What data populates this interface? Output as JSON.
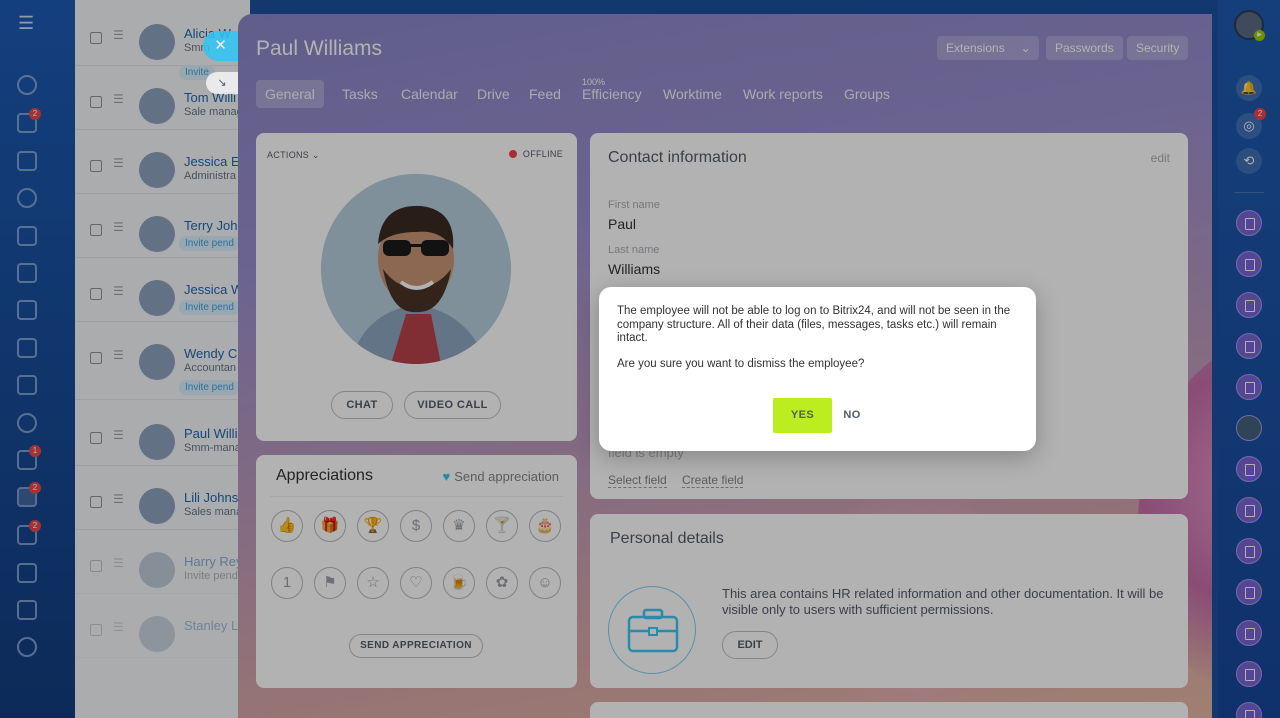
{
  "leftnav": {
    "badges": [
      "2",
      "1",
      "2",
      "2"
    ]
  },
  "employee_list": {
    "rows": [
      {
        "name": "Alicia W",
        "position": "Smm",
        "tag": "Invite"
      },
      {
        "name": "Tom Willi",
        "position": "Sale manag",
        "tag": ""
      },
      {
        "name": "Jessica E",
        "position": "Administra",
        "tag": ""
      },
      {
        "name": "Terry Joh",
        "position": "",
        "tag": "Invite pend"
      },
      {
        "name": "Jessica W",
        "position": "",
        "tag": "Invite pend"
      },
      {
        "name": "Wendy Cl",
        "position": "Accountan",
        "tag": "Invite pend"
      },
      {
        "name": "Paul Willi",
        "position": "Smm-mana",
        "tag": ""
      },
      {
        "name": "Lili Johns",
        "position": "Sales mana",
        "tag": ""
      },
      {
        "name": "Harry Rey",
        "position": "Invite pend",
        "tag": ""
      },
      {
        "name": "Stanley L",
        "position": "",
        "tag": ""
      }
    ]
  },
  "slider": {
    "close_icon": "✕",
    "minimize_icon": "↘",
    "title": "Paul Williams",
    "top_buttons": {
      "extensions": "Extensions",
      "passwords": "Passwords",
      "security": "Security"
    },
    "tabs": [
      {
        "label": "General",
        "active": true
      },
      {
        "label": "Tasks"
      },
      {
        "label": "Calendar"
      },
      {
        "label": "Drive"
      },
      {
        "label": "Feed"
      },
      {
        "label": "Efficiency",
        "super": "100%"
      },
      {
        "label": "Worktime"
      },
      {
        "label": "Work reports"
      },
      {
        "label": "Groups"
      }
    ]
  },
  "profile": {
    "actions": "ACTIONS",
    "status": "OFFLINE",
    "status_color": "#f0444b",
    "chat": "CHAT",
    "video_call": "VIDEO CALL"
  },
  "appreciations": {
    "title": "Appreciations",
    "send_link": "Send appreciation",
    "send_button": "SEND APPRECIATION",
    "icons": [
      "thumbs-up-icon",
      "gift-icon",
      "trophy-icon",
      "money-bag-icon",
      "crown-icon",
      "cocktail-icon",
      "cake-icon",
      "number-one-icon",
      "flag-icon",
      "star-icon",
      "heart-icon",
      "beer-icon",
      "flower-icon",
      "smile-icon"
    ],
    "glyphs": [
      "👍",
      "🎁",
      "🏆",
      "$",
      "♛",
      "🍸",
      "🎂",
      "1",
      "⚑",
      "☆",
      "♡",
      "🍺",
      "✿",
      "☺"
    ]
  },
  "contact": {
    "title": "Contact information",
    "edit": "edit",
    "first_name_label": "First name",
    "first_name": "Paul",
    "last_name_label": "Last name",
    "last_name": "Williams",
    "empty_hint": "field is empty",
    "select_field": "Select field",
    "create_field": "Create field"
  },
  "personal": {
    "title": "Personal details",
    "text": "This area contains HR related information and other documentation. It will be visible only to users with sufficient permissions.",
    "edit": "EDIT"
  },
  "rightbar": {
    "badge": "2"
  },
  "dialog": {
    "message": "The employee will not be able to log on to Bitrix24, and will not be seen in the company structure. All of their data (files, messages, tasks etc.) will remain intact.",
    "question": "Are you sure you want to dismiss the employee?",
    "yes": "YES",
    "no": "NO",
    "yes_color": "#bbed21"
  }
}
